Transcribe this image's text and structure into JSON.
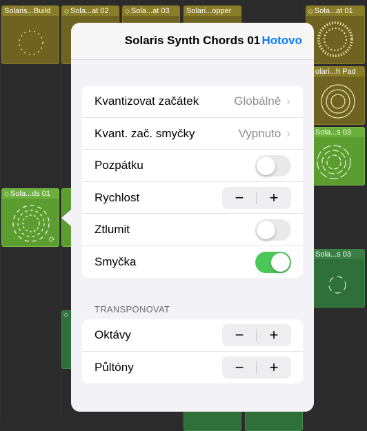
{
  "clips": {
    "top": [
      {
        "name": "Solaris...Build",
        "chevron": false
      },
      {
        "name": "Sola...at 02",
        "chevron": true
      },
      {
        "name": "Sola...at 03",
        "chevron": true
      },
      {
        "name": "Solari...opper",
        "chevron": false
      },
      {
        "name": "Sola...at 01",
        "chevron": true
      }
    ],
    "right": [
      {
        "name": "olari...h Pad"
      },
      {
        "name": "Sola...s 03"
      },
      {
        "name": "Sola...s 03"
      }
    ],
    "left": {
      "name": "Sola...ds 01",
      "chevron": true
    }
  },
  "popover": {
    "title": "Solaris Synth Chords 01",
    "done_label": "Hotovo",
    "rows": [
      {
        "label": "Kvantizovat začátek",
        "value": "Globálně"
      },
      {
        "label": "Kvant. zač. smyčky",
        "value": "Vypnuto"
      },
      {
        "label": "Pozpátku",
        "toggle": false
      },
      {
        "label": "Rychlost"
      },
      {
        "label": "Ztlumit",
        "toggle": false
      },
      {
        "label": "Smyčka",
        "toggle": true
      }
    ],
    "transpose_header": "TRANSPONOVAT",
    "transpose_rows": [
      {
        "label": "Oktávy"
      },
      {
        "label": "Půltóny"
      }
    ],
    "stepper": {
      "minus": "−",
      "plus": "+"
    },
    "chevron_glyph": "›"
  },
  "colors": {
    "accent": "#0a7aff",
    "toggle_on": "#4cc759",
    "clip_gold": "#6e6320",
    "clip_green": "#5c9d2f",
    "clip_dark_green": "#2f6f3a"
  }
}
